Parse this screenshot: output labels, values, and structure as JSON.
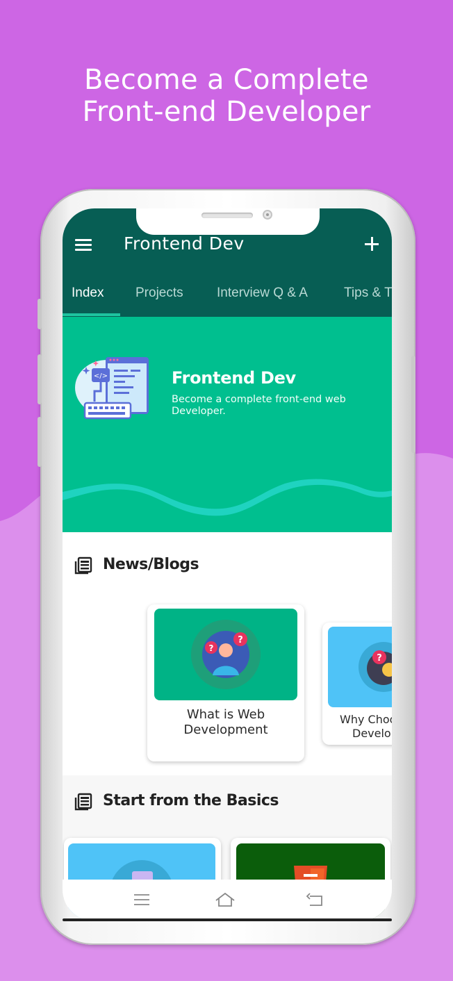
{
  "promo": {
    "headline_line1": "Become a Complete",
    "headline_line2": "Front-end Developer",
    "background_color": "#cd66e4"
  },
  "app": {
    "title": "Frontend Dev",
    "menu_icon": "hamburger-menu-icon",
    "add_icon": "plus-icon",
    "primary_color": "#075e54",
    "accent_color": "#00bf8f"
  },
  "tabs": [
    {
      "label": "Index",
      "active": true
    },
    {
      "label": "Projects",
      "active": false
    },
    {
      "label": "Interview Q & A",
      "active": false
    },
    {
      "label": "Tips & Tricks",
      "active": false
    }
  ],
  "hero": {
    "title": "Frontend Dev",
    "subtitle": "Become a complete front-end web Developer.",
    "illustration": "code-editor-illustration"
  },
  "sections": {
    "news": {
      "title": "News/Blogs",
      "icon": "newspaper-icon",
      "cards": [
        {
          "label_line1": "What is Web",
          "label_line2": "Development",
          "image": "person-question-illustration",
          "image_bg": "#00b386"
        },
        {
          "label_line1": "Why Choose",
          "label_line2": "Development",
          "image": "question-illustration",
          "image_bg": "#4fc3f7"
        }
      ]
    },
    "basics": {
      "title": "Start from the Basics",
      "icon": "newspaper-icon",
      "cards": [
        {
          "image": "file-illustration",
          "image_bg": "#4fc3f7"
        },
        {
          "image": "html5-illustration",
          "image_bg": "#0b5d0b"
        }
      ]
    }
  },
  "navbar": {
    "recents_icon": "recents-icon",
    "home_icon": "home-icon",
    "back_icon": "back-icon"
  }
}
